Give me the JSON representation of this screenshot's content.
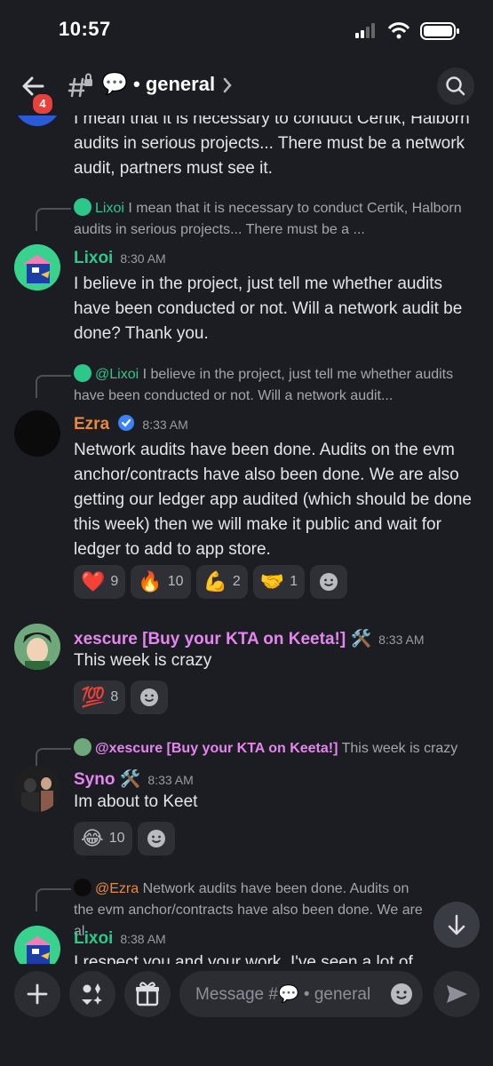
{
  "status": {
    "time": "10:57"
  },
  "header": {
    "back_badge": "4",
    "channel_emoji": "💬",
    "channel_name": "• general"
  },
  "messages": {
    "m0": {
      "text": "I mean that it is necessary to conduct Certik, Halborn audits in serious projects... There must be a network audit, partners must see it."
    },
    "m1": {
      "reply_to": "Lixoi",
      "reply_text": "I mean that it is necessary to conduct Certik, Halborn audits in serious projects... There must be a ...",
      "author": "Lixoi",
      "time": "8:30 AM",
      "text": "I believe in the project, just tell me whether audits have been conducted or not. Will a network audit be done? Thank you."
    },
    "m2": {
      "reply_to": "@Lixoi",
      "reply_text": "I believe in the project, just tell me whether audits have been conducted or not. Will a network audit...",
      "author": "Ezra",
      "time": "8:33 AM",
      "text": "Network audits have been done. Audits on the evm anchor/contracts have also been done. We are also getting our ledger app audited (which should be done this week) then we will make it public and wait for ledger to add to app store.",
      "reactions": [
        {
          "emoji": "❤️",
          "count": "9"
        },
        {
          "emoji": "🔥",
          "count": "10"
        },
        {
          "emoji": "💪",
          "count": "2"
        },
        {
          "emoji": "🤝",
          "count": "1"
        }
      ]
    },
    "m3": {
      "author": "xescure [Buy your KTA on Keeta!]",
      "badge": "🛠️",
      "time": "8:33 AM",
      "text": "This week is crazy",
      "reactions": [
        {
          "emoji": "💯",
          "count": "8"
        }
      ]
    },
    "m4": {
      "reply_to": "@xescure [Buy your KTA on Keeta!]",
      "reply_text": "This week is crazy",
      "author": "Syno",
      "badge": "🛠️",
      "time": "8:33 AM",
      "text": "Im about to Keet",
      "reactions": [
        {
          "emoji": "😂",
          "count": "10"
        }
      ]
    },
    "m5": {
      "reply_to": "@Ezra",
      "reply_text": "Network audits have been done. Audits on the evm anchor/contracts have also been done. We are al...",
      "author": "Lixoi",
      "time": "8:38 AM",
      "text": "I respect you and your work. I've seen a lot of"
    }
  },
  "composer": {
    "placeholder_prefix": "Message #",
    "placeholder_emoji": "💬",
    "placeholder_channel": "• general"
  },
  "colors": {
    "lixoi": "#2dc78a",
    "ezra": "#e8883a",
    "pink": "#e585ef",
    "verified": "#3b82f6",
    "badge_red": "#e8413c"
  }
}
